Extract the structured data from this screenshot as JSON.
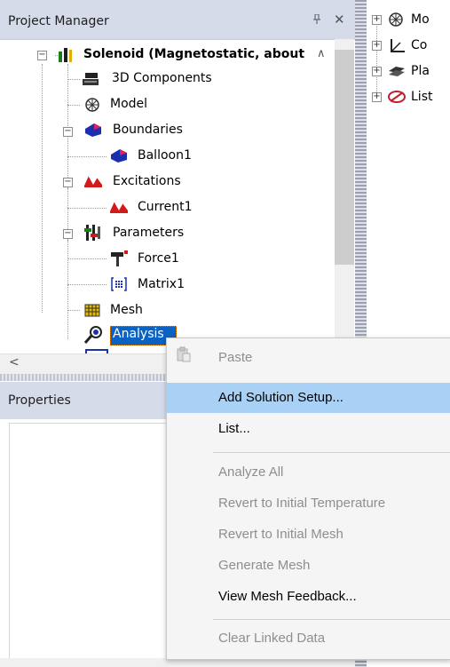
{
  "project_manager": {
    "title": "Project Manager",
    "pin_glyph": "1 ",
    "pin": "ߐ",
    "close": "✕",
    "tree": {
      "root": "Solenoid (Magnetostatic, about",
      "components": "3D Components",
      "model": "Model",
      "boundaries": "Boundaries",
      "balloon": "Balloon1",
      "excitations": "Excitations",
      "current": "Current1",
      "parameters": "Parameters",
      "force": "Force1",
      "matrix": "Matrix1",
      "mesh": "Mesh",
      "analysis": "Analysis"
    },
    "scroll_left": "<",
    "scroll_up": "^"
  },
  "properties": {
    "title": "Properties"
  },
  "right_panel": {
    "items": [
      "Mo",
      "Co",
      "Pla",
      "List"
    ]
  },
  "context_menu": {
    "items": [
      {
        "label": "Paste",
        "enabled": false
      },
      {
        "label": "Add Solution Setup...",
        "enabled": true
      },
      {
        "label": "List...",
        "enabled": true
      },
      {
        "label": "Analyze All",
        "enabled": false
      },
      {
        "label": "Revert to Initial Temperature",
        "enabled": false
      },
      {
        "label": "Revert to Initial Mesh",
        "enabled": false
      },
      {
        "label": "Generate Mesh",
        "enabled": false
      },
      {
        "label": "View Mesh Feedback...",
        "enabled": true
      },
      {
        "label": "Clear Linked Data",
        "enabled": false
      }
    ]
  },
  "colors": {
    "header": "#d6dbe9",
    "highlight": "#a9d1f5",
    "selected": "#0a62c4"
  }
}
